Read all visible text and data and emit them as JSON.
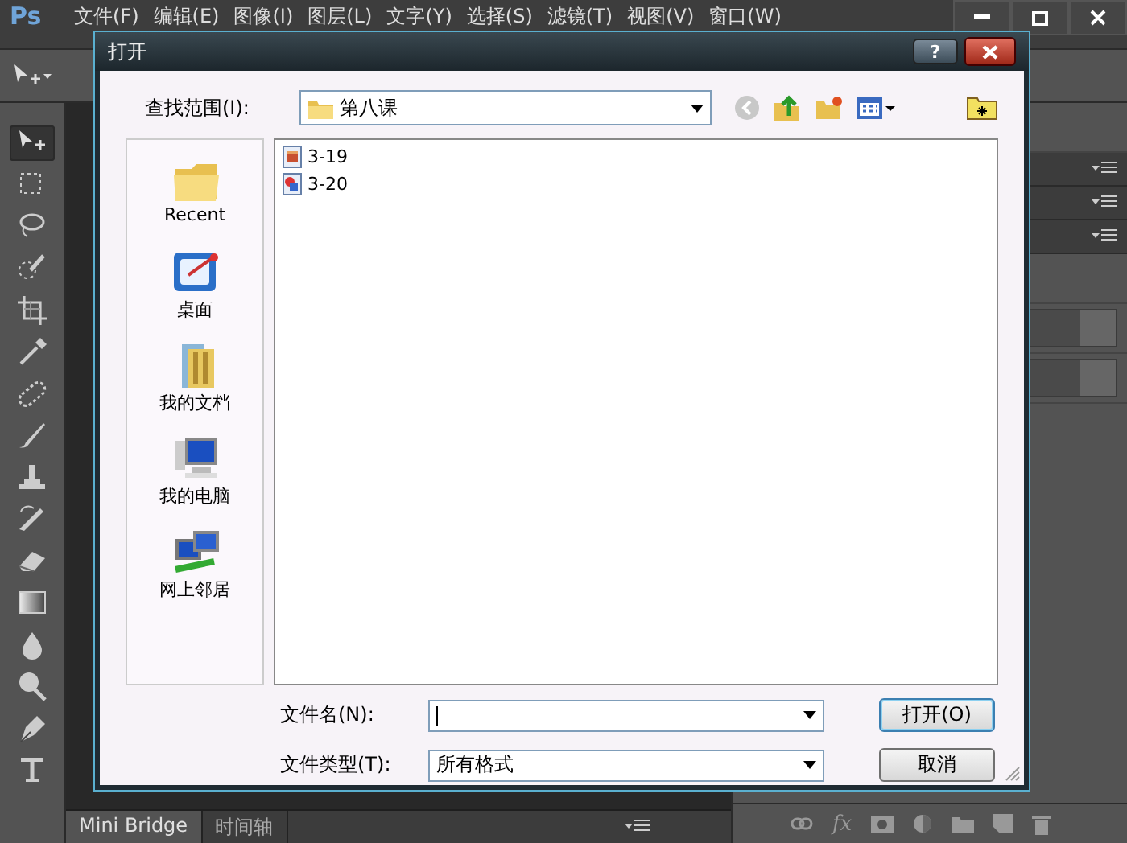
{
  "app": {
    "logo": "Ps",
    "menus": [
      "文件(F)",
      "编辑(E)",
      "图像(I)",
      "图层(L)",
      "文字(Y)",
      "选择(S)",
      "滤镜(T)",
      "视图(V)",
      "窗口(W)"
    ]
  },
  "tools": [
    {
      "kind": "move",
      "selected": true
    },
    {
      "kind": "marquee",
      "selected": false
    },
    {
      "kind": "lasso",
      "selected": false
    },
    {
      "kind": "quick",
      "selected": false
    },
    {
      "kind": "crop",
      "selected": false
    },
    {
      "kind": "dropper",
      "selected": false
    },
    {
      "kind": "heal",
      "selected": false
    },
    {
      "kind": "brush",
      "selected": false
    },
    {
      "kind": "stamp",
      "selected": false
    },
    {
      "kind": "history",
      "selected": false
    },
    {
      "kind": "eraser",
      "selected": false
    },
    {
      "kind": "gradient",
      "selected": false
    },
    {
      "kind": "blur",
      "selected": false
    },
    {
      "kind": "dodge",
      "selected": false
    },
    {
      "kind": "pen",
      "selected": false
    },
    {
      "kind": "type",
      "selected": false
    }
  ],
  "bottom_tabs": [
    {
      "label": "Mini Bridge",
      "selected": true
    },
    {
      "label": "时间轴",
      "selected": false
    }
  ],
  "layers_footer": {
    "fx": "fx"
  },
  "dialog": {
    "title": "打开",
    "help": "?",
    "look_in": {
      "label": "查找范围(I):",
      "value": "第八课"
    },
    "places": [
      {
        "kind": "recent",
        "label": "Recent"
      },
      {
        "kind": "desktop",
        "label": "桌面"
      },
      {
        "kind": "documents",
        "label": "我的文档"
      },
      {
        "kind": "computer",
        "label": "我的电脑"
      },
      {
        "kind": "network",
        "label": "网上邻居"
      }
    ],
    "files": [
      {
        "kind": "image",
        "name": "3-19"
      },
      {
        "kind": "graphic",
        "name": "3-20"
      }
    ],
    "file_name": {
      "label": "文件名(N):"
    },
    "file_type": {
      "label": "文件类型(T):",
      "value": "所有格式"
    },
    "buttons": [
      {
        "label": "打开(O)",
        "default": true
      },
      {
        "label": "取消",
        "default": false
      }
    ]
  }
}
